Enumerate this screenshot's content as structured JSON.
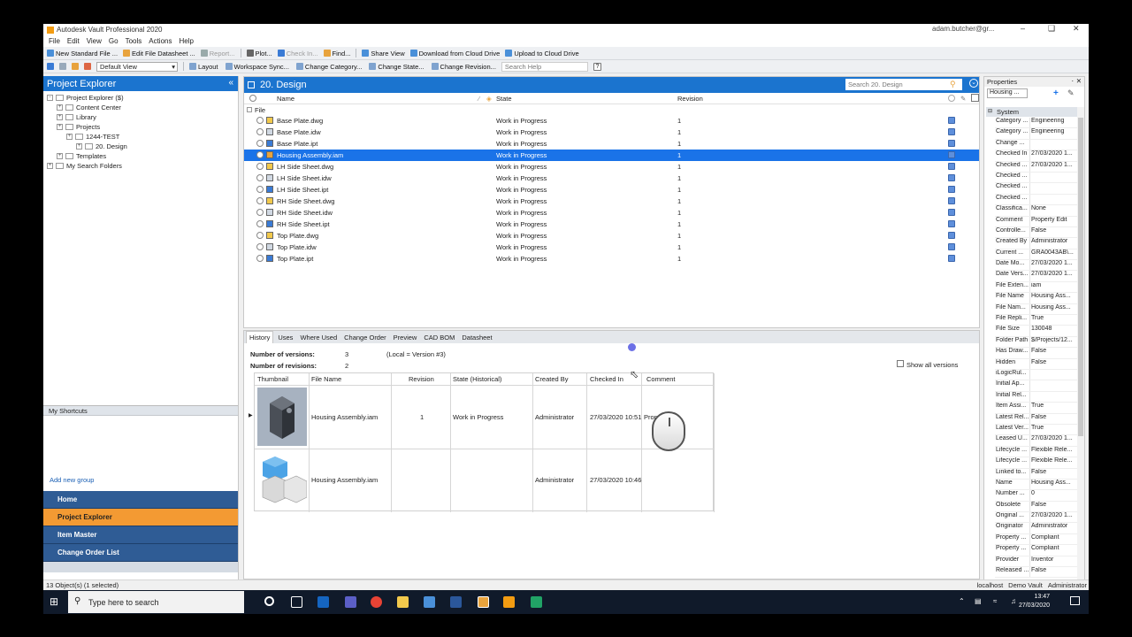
{
  "window": {
    "title": "Autodesk Vault Professional 2020",
    "user": "adam.butcher@gr..."
  },
  "menu": [
    "File",
    "Edit",
    "View",
    "Go",
    "Tools",
    "Actions",
    "Help"
  ],
  "toolbar1": [
    {
      "label": "New Standard File ...",
      "disabled": false
    },
    {
      "label": "Edit File Datasheet ...",
      "disabled": false
    },
    {
      "label": "Report...",
      "disabled": true
    },
    {
      "label": "Plot...",
      "disabled": false
    },
    {
      "label": "Check In...",
      "disabled": true
    },
    {
      "label": "Find...",
      "disabled": false
    },
    {
      "label": "Share View",
      "disabled": false
    },
    {
      "label": "Download from Cloud Drive",
      "disabled": false
    },
    {
      "label": "Upload to Cloud Drive",
      "disabled": false
    }
  ],
  "toolbar2": {
    "view_select": "Default View",
    "buttons": [
      "Layout",
      "Workspace Sync...",
      "Change Category...",
      "Change State...",
      "Change Revision..."
    ],
    "search_placeholder": "Search Help"
  },
  "explorer": {
    "title": "Project Explorer",
    "tree": [
      {
        "label": "Project Explorer ($)",
        "level": 0
      },
      {
        "label": "Content Center",
        "level": 1
      },
      {
        "label": "Library",
        "level": 1
      },
      {
        "label": "Projects",
        "level": 1
      },
      {
        "label": "1244-TEST",
        "level": 2
      },
      {
        "label": "20. Design",
        "level": 3
      },
      {
        "label": "Templates",
        "level": 1
      },
      {
        "label": "My Search Folders",
        "level": 0
      }
    ],
    "shortcuts_title": "My Shortcuts",
    "add_group": "Add new group",
    "nav": [
      {
        "label": "Home",
        "active": false
      },
      {
        "label": "Project Explorer",
        "active": true
      },
      {
        "label": "Item Master",
        "active": false
      },
      {
        "label": "Change Order List",
        "active": false
      }
    ]
  },
  "main": {
    "folder_title": "20. Design",
    "search_placeholder": "Search 20. Design",
    "columns": {
      "name": "Name",
      "state": "State",
      "revision": "Revision"
    },
    "group_label": "File",
    "files": [
      {
        "name": "Base Plate.dwg",
        "state": "Work in Progress",
        "revision": "1",
        "type": "dwg"
      },
      {
        "name": "Base Plate.idw",
        "state": "Work in Progress",
        "revision": "1",
        "type": "idw"
      },
      {
        "name": "Base Plate.ipt",
        "state": "Work in Progress",
        "revision": "1",
        "type": "ipt"
      },
      {
        "name": "Housing Assembly.iam",
        "state": "Work in Progress",
        "revision": "1",
        "type": "iam",
        "selected": true
      },
      {
        "name": "LH Side Sheet.dwg",
        "state": "Work in Progress",
        "revision": "1",
        "type": "dwg"
      },
      {
        "name": "LH Side Sheet.idw",
        "state": "Work in Progress",
        "revision": "1",
        "type": "idw"
      },
      {
        "name": "LH Side Sheet.ipt",
        "state": "Work in Progress",
        "revision": "1",
        "type": "ipt"
      },
      {
        "name": "RH Side Sheet.dwg",
        "state": "Work in Progress",
        "revision": "1",
        "type": "dwg"
      },
      {
        "name": "RH Side Sheet.idw",
        "state": "Work in Progress",
        "revision": "1",
        "type": "idw"
      },
      {
        "name": "RH Side Sheet.ipt",
        "state": "Work in Progress",
        "revision": "1",
        "type": "ipt"
      },
      {
        "name": "Top Plate.dwg",
        "state": "Work in Progress",
        "revision": "1",
        "type": "dwg"
      },
      {
        "name": "Top Plate.idw",
        "state": "Work in Progress",
        "revision": "1",
        "type": "idw"
      },
      {
        "name": "Top Plate.ipt",
        "state": "Work in Progress",
        "revision": "1",
        "type": "ipt"
      }
    ]
  },
  "history": {
    "tabs": [
      "History",
      "Uses",
      "Where Used",
      "Change Order",
      "Preview",
      "CAD BOM",
      "Datasheet"
    ],
    "active_tab": "History",
    "versions_label": "Number of versions:",
    "versions_value": "3",
    "local_note": "(Local = Version #3)",
    "revisions_label": "Number of revisions:",
    "revisions_value": "2",
    "show_all": "Show all versions",
    "columns": [
      "Thumbnail",
      "File Name",
      "Revision",
      "State (Historical)",
      "Created By",
      "Checked In",
      "Comment"
    ],
    "rows": [
      {
        "file": "Housing Assembly.iam",
        "revision": "1",
        "state": "Work in Progress",
        "created_by": "Administrator",
        "checked_in": "27/03/2020 10:51",
        "comment": "Prop..."
      },
      {
        "file": "Housing Assembly.iam",
        "revision": "",
        "state": "",
        "created_by": "Administrator",
        "checked_in": "27/03/2020 10:46",
        "comment": ""
      }
    ]
  },
  "properties": {
    "title": "Properties",
    "selector": "Housing ...",
    "group": "System",
    "rows": [
      [
        "Category ...",
        "Engineering"
      ],
      [
        "Category ...",
        "Engineering"
      ],
      [
        "Change ...",
        ""
      ],
      [
        "Checked In",
        "27/03/2020 1..."
      ],
      [
        "Checked ...",
        "27/03/2020 1..."
      ],
      [
        "Checked ...",
        ""
      ],
      [
        "Checked ...",
        ""
      ],
      [
        "Checked ...",
        ""
      ],
      [
        "Classifica...",
        "None"
      ],
      [
        "Comment",
        "Property Edit"
      ],
      [
        "Controlle...",
        "False"
      ],
      [
        "Created By",
        "Administrator"
      ],
      [
        "Current ...",
        "GRA0043AB\\..."
      ],
      [
        "Date Mo...",
        "27/03/2020 1..."
      ],
      [
        "Date Vers...",
        "27/03/2020 1..."
      ],
      [
        "File Exten...",
        "iam"
      ],
      [
        "File Name",
        "Housing Ass..."
      ],
      [
        "File Nam...",
        "Housing Ass..."
      ],
      [
        "File Repli...",
        "True"
      ],
      [
        "File Size",
        "130048"
      ],
      [
        "Folder Path",
        "$/Projects/12..."
      ],
      [
        "Has Draw...",
        "False"
      ],
      [
        "Hidden",
        "False"
      ],
      [
        "iLogicRul...",
        ""
      ],
      [
        "Initial Ap...",
        ""
      ],
      [
        "Initial Rel...",
        ""
      ],
      [
        "Item Assi...",
        "True"
      ],
      [
        "Latest Rel...",
        "False"
      ],
      [
        "Latest Ver...",
        "True"
      ],
      [
        "Leased U...",
        "27/03/2020 1..."
      ],
      [
        "Lifecycle ...",
        "Flexible Rele..."
      ],
      [
        "Lifecycle ...",
        "Flexible Rele..."
      ],
      [
        "Linked to...",
        "False"
      ],
      [
        "Name",
        "Housing Ass..."
      ],
      [
        "Number ...",
        "0"
      ],
      [
        "Obsolete",
        "False"
      ],
      [
        "Original ...",
        "27/03/2020 1..."
      ],
      [
        "Originator",
        "Administrator"
      ],
      [
        "Property ...",
        "Compliant"
      ],
      [
        "Property ...",
        "Compliant"
      ],
      [
        "Provider",
        "Inventor"
      ],
      [
        "Released ...",
        "False"
      ]
    ]
  },
  "status": {
    "left": "13 Object(s) (1 selected)",
    "server": "localhost",
    "vault": "Demo Vault",
    "user": "Administrator"
  },
  "taskbar": {
    "search_placeholder": "Type here to search",
    "time": "13:47",
    "date": "27/03/2020"
  }
}
